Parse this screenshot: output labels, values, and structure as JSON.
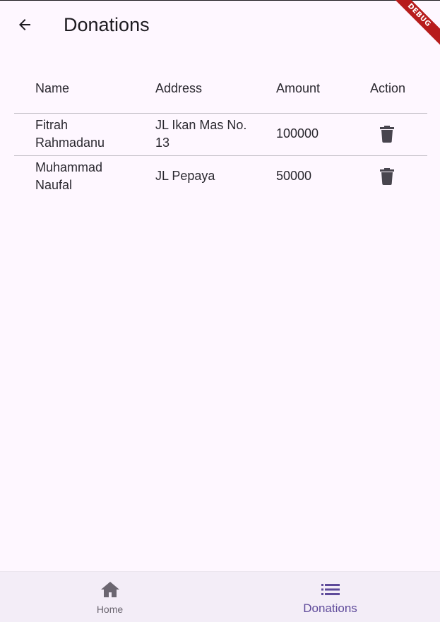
{
  "appbar": {
    "title": "Donations",
    "back_icon": "arrow-back-icon"
  },
  "debug_banner": "DEBUG",
  "table": {
    "headers": [
      "Name",
      "Address",
      "Amount",
      "Action"
    ],
    "rows": [
      {
        "name": "Fitrah Rahmadanu",
        "address": "JL Ikan Mas No. 13",
        "amount": "100000",
        "action_icon": "trash-icon"
      },
      {
        "name": "Muhammad Naufal",
        "address": "JL Pepaya",
        "amount": "50000",
        "action_icon": "trash-icon"
      }
    ]
  },
  "bottom_nav": {
    "items": [
      {
        "label": "Home",
        "icon": "home-icon",
        "active": false
      },
      {
        "label": "Donations",
        "icon": "list-icon",
        "active": true
      }
    ]
  },
  "colors": {
    "background": "#fef7ff",
    "text": "#1d1b20",
    "divider": "#c4c0c8",
    "nav_background": "#f3edf7",
    "active_accent": "#5e4a9a",
    "inactive": "#6b6670",
    "debug_ribbon": "#b71c1c"
  }
}
